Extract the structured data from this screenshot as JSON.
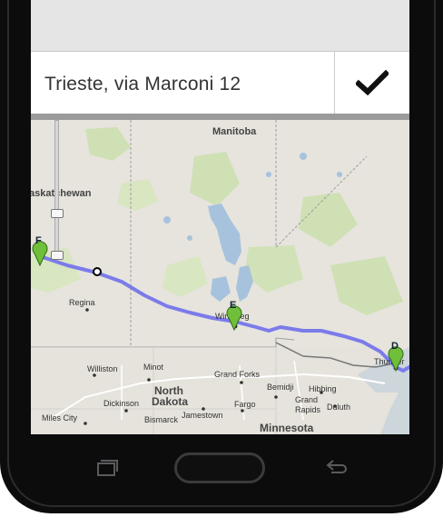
{
  "address": {
    "text": "Trieste, via Marconi 12"
  },
  "map": {
    "labels": {
      "manitoba": "Manitoba",
      "saskatchewan": "askatchewan",
      "regina": "Regina",
      "winnipeg": "Winnipeg",
      "thunder": "Thunder",
      "williston": "Williston",
      "minot": "Minot",
      "grand_forks": "Grand Forks",
      "bemidji": "Bemidji",
      "hibbing": "Hibbing",
      "north_dakota_1": "North",
      "north_dakota_2": "Dakota",
      "dickinson": "Dickinson",
      "fargo": "Fargo",
      "grand_rapids_1": "Grand",
      "grand_rapids_2": "Rapids",
      "duluth": "Duluth",
      "miles_city": "Miles City",
      "bismarck": "Bismarck",
      "jamestown": "Jamestown",
      "minnesota": "Minnesota"
    },
    "markers": {
      "f": "F",
      "e": "E",
      "d": "D"
    },
    "colors": {
      "route": "#7b7bea",
      "marker": "#6fbf3a"
    }
  },
  "nav": {
    "recent": "recent-apps-icon",
    "home": "home-button",
    "back": "back-icon"
  }
}
